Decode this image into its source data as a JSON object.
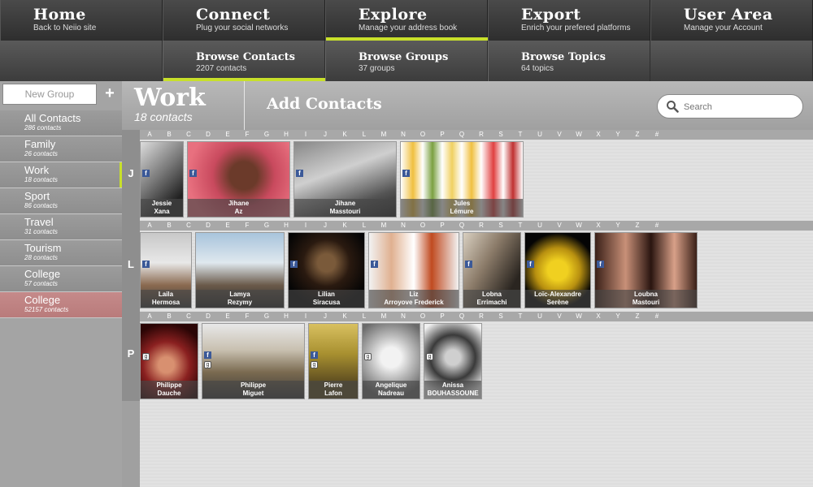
{
  "topnav": [
    {
      "title": "Home",
      "subtitle": "Back to Neiio site"
    },
    {
      "title": "Connect",
      "subtitle": "Plug your social networks"
    },
    {
      "title": "Explore",
      "subtitle": "Manage your address book"
    },
    {
      "title": "Export",
      "subtitle": "Enrich your prefered platforms"
    },
    {
      "title": "User Area",
      "subtitle": "Manage your Account"
    }
  ],
  "subnav": [
    {
      "title": "Browse Contacts",
      "subtitle": "2207 contacts"
    },
    {
      "title": "Browse Groups",
      "subtitle": "37 groups"
    },
    {
      "title": "Browse Topics",
      "subtitle": "64 topics"
    }
  ],
  "sidebar": {
    "new_group_placeholder": "New Group",
    "groups": [
      {
        "name": "All Contacts",
        "count": "286 contacts"
      },
      {
        "name": "Family",
        "count": "26 contacts"
      },
      {
        "name": "Work",
        "count": "18 contacts"
      },
      {
        "name": "Sport",
        "count": "86 contacts"
      },
      {
        "name": "Travel",
        "count": "31 contacts"
      },
      {
        "name": "Tourism",
        "count": "28 contacts"
      },
      {
        "name": "College",
        "count": "57 contacts"
      },
      {
        "name": "College",
        "count": "52157 contacts"
      }
    ]
  },
  "header": {
    "group_title": "Work",
    "group_count": "18 contacts",
    "add_contacts": "Add Contacts",
    "search_placeholder": "Search"
  },
  "alphabet": [
    "A",
    "B",
    "C",
    "D",
    "E",
    "F",
    "G",
    "H",
    "I",
    "J",
    "K",
    "L",
    "M",
    "N",
    "O",
    "P",
    "Q",
    "R",
    "S",
    "T",
    "U",
    "V",
    "W",
    "X",
    "Y",
    "Z",
    "#"
  ],
  "sections": [
    {
      "letter": "J",
      "contacts": [
        {
          "first": "Jessie",
          "last": "Xana"
        },
        {
          "first": "Jihane",
          "last": "Az"
        },
        {
          "first": "Jihane",
          "last": "Masstouri"
        },
        {
          "first": "Jules",
          "last": "Lémure"
        }
      ]
    },
    {
      "letter": "L",
      "contacts": [
        {
          "first": "Laila",
          "last": "Hermosa"
        },
        {
          "first": "Lamya",
          "last": "Rezymy"
        },
        {
          "first": "Lilian",
          "last": "Siracusa"
        },
        {
          "first": "Liz",
          "last": "Arroyove Frederick"
        },
        {
          "first": "Lobna",
          "last": "Errimachi"
        },
        {
          "first": "Loïc-Alexandre",
          "last": "Serène"
        },
        {
          "first": "Loubna",
          "last": "Mastouri"
        }
      ]
    },
    {
      "letter": "P",
      "contacts": [
        {
          "first": "Philippe",
          "last": "Dauche"
        },
        {
          "first": "Philippe",
          "last": "Miguet"
        },
        {
          "first": "Pierre",
          "last": "Lafon"
        },
        {
          "first": "Angelique",
          "last": "Nadreau"
        },
        {
          "first": "Anissa",
          "last": "BOUHASSOUNE"
        }
      ]
    }
  ]
}
